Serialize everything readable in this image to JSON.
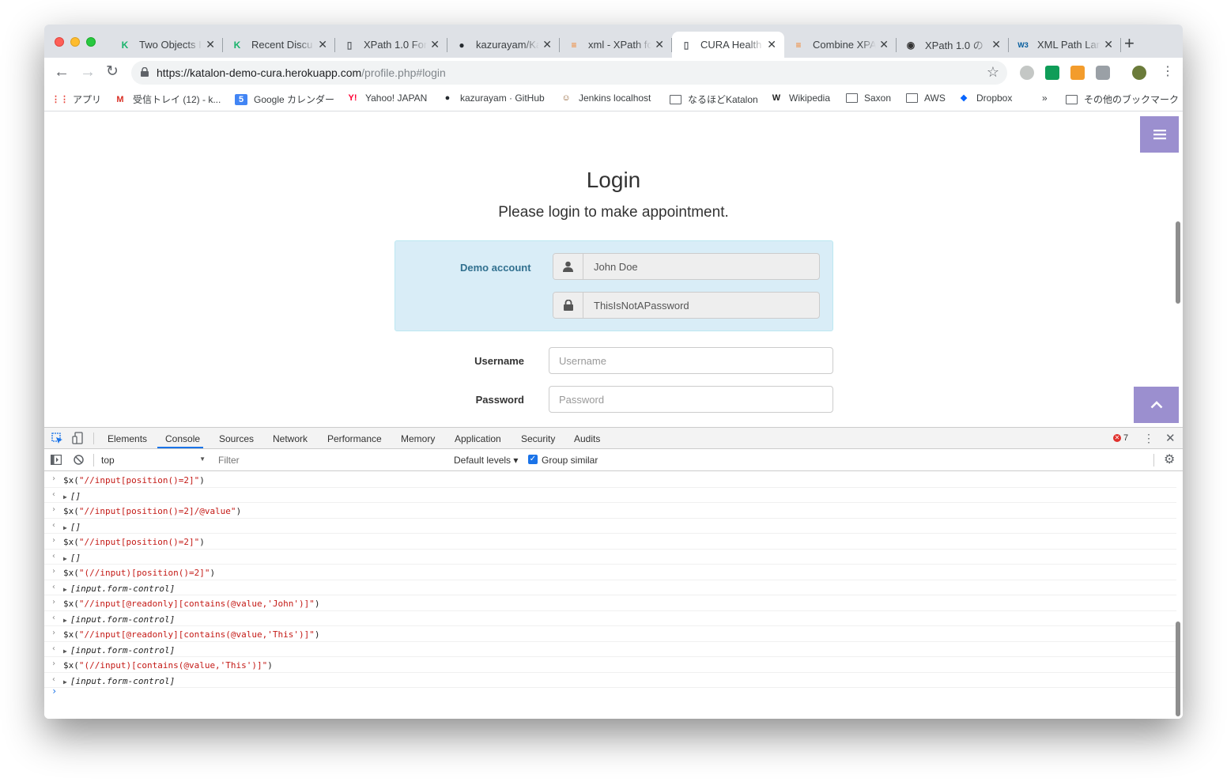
{
  "tabs": [
    {
      "title": "Two Objects I",
      "icon": "katalon-icon",
      "active": false
    },
    {
      "title": "Recent Discu",
      "icon": "katalon-icon",
      "active": false
    },
    {
      "title": "XPath 1.0 For",
      "icon": "page-icon",
      "active": false
    },
    {
      "title": "kazurayam/Ka",
      "icon": "github-icon",
      "active": false
    },
    {
      "title": "xml - XPath fo",
      "icon": "stackoverflow-icon",
      "active": false
    },
    {
      "title": "CURA Health",
      "icon": "page-icon",
      "active": true
    },
    {
      "title": "Combine XPA",
      "icon": "stackoverflow-icon",
      "active": false
    },
    {
      "title": "XPath 1.0 の",
      "icon": "xpath-icon",
      "active": false
    },
    {
      "title": "XML Path Lan",
      "icon": "w3c-icon",
      "active": false
    }
  ],
  "url": {
    "host": "https://katalon-demo-cura.herokuapp.com",
    "path": "/profile.php#login"
  },
  "bookmarks": [
    {
      "label": "アプリ",
      "icon": "apps-grid-icon"
    },
    {
      "label": "受信トレイ (12) - k...",
      "icon": "gmail-icon"
    },
    {
      "label": "Google カレンダー",
      "icon": "calendar-icon"
    },
    {
      "label": "Yahoo! JAPAN",
      "icon": "yahoo-icon"
    },
    {
      "label": "kazurayam · GitHub",
      "icon": "github-icon"
    },
    {
      "label": "Jenkins localhost",
      "icon": "jenkins-icon"
    },
    {
      "label": "なるほどKatalon",
      "icon": "folder-icon"
    },
    {
      "label": "Wikipedia",
      "icon": "wikipedia-icon"
    },
    {
      "label": "Saxon",
      "icon": "folder-icon"
    },
    {
      "label": "AWS",
      "icon": "folder-icon"
    },
    {
      "label": "Dropbox",
      "icon": "dropbox-icon"
    }
  ],
  "bookmarks_more": "»",
  "bookmarks_other": "その他のブックマーク",
  "page": {
    "title": "Login",
    "subtitle": "Please login to make appointment.",
    "demo_label": "Demo account",
    "demo_username": "John Doe",
    "demo_password": "ThisIsNotAPassword",
    "username_label": "Username",
    "username_placeholder": "Username",
    "password_label": "Password",
    "password_placeholder": "Password"
  },
  "devtools": {
    "tabs": [
      "Elements",
      "Console",
      "Sources",
      "Network",
      "Performance",
      "Memory",
      "Application",
      "Security",
      "Audits"
    ],
    "active_tab": "Console",
    "error_count": "7",
    "context": "top",
    "filter_placeholder": "Filter",
    "levels": "Default levels ▾",
    "group_similar": "Group similar",
    "console_lines": [
      {
        "type": "in",
        "pre": "$x(",
        "str": "\"//input[position()=2]\"",
        "post": ")"
      },
      {
        "type": "out",
        "result": "[]"
      },
      {
        "type": "in",
        "pre": "$x(",
        "str": "\"//input[position()=2]/@value\"",
        "post": ")"
      },
      {
        "type": "out",
        "result": "[]"
      },
      {
        "type": "in",
        "pre": "$x(",
        "str": "\"//input[position()=2]\"",
        "post": ")"
      },
      {
        "type": "out",
        "result": "[]"
      },
      {
        "type": "in",
        "pre": "$x(",
        "str": "\"(//input)[position()=2]\"",
        "post": ")"
      },
      {
        "type": "out",
        "result": "[input.form-control]"
      },
      {
        "type": "in",
        "pre": "$x(",
        "str": "\"//input[@readonly][contains(@value,'John')]\"",
        "post": ")"
      },
      {
        "type": "out",
        "result": "[input.form-control]"
      },
      {
        "type": "in",
        "pre": "$x(",
        "str": "\"//input[@readonly][contains(@value,'This')]\"",
        "post": ")"
      },
      {
        "type": "out",
        "result": "[input.form-control]"
      },
      {
        "type": "in",
        "pre": "$x(",
        "str": "\"(//input)[contains(@value,'This')]\"",
        "post": ")"
      },
      {
        "type": "out",
        "result": "[input.form-control]"
      }
    ],
    "prompt": "›"
  },
  "colors": {
    "accent_purple": "#9b8fcf",
    "demo_bg": "#d9edf7",
    "demo_text": "#31708f",
    "console_string": "#c41a16"
  }
}
